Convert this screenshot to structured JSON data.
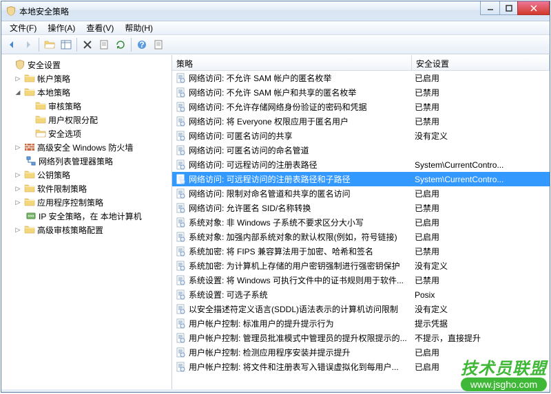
{
  "window": {
    "title": "本地安全策略"
  },
  "menu": {
    "file": "文件(F)",
    "action": "操作(A)",
    "view": "查看(V)",
    "help": "帮助(H)"
  },
  "tree": {
    "root": "安全设置",
    "n1": "帐户策略",
    "n2": "本地策略",
    "n2a": "审核策略",
    "n2b": "用户权限分配",
    "n2c": "安全选项",
    "n3": "高级安全 Windows 防火墙",
    "n4": "网络列表管理器策略",
    "n5": "公钥策略",
    "n6": "软件限制策略",
    "n7": "应用程序控制策略",
    "n8": "IP 安全策略，在 本地计算机",
    "n9": "高级审核策略配置"
  },
  "columns": {
    "c1": "策略",
    "c2": "安全设置"
  },
  "rows": [
    {
      "policy": "网络访问: 不允许 SAM 帐户的匿名枚举",
      "value": "已启用"
    },
    {
      "policy": "网络访问: 不允许 SAM 帐户和共享的匿名枚举",
      "value": "已禁用"
    },
    {
      "policy": "网络访问: 不允许存储网络身份验证的密码和凭据",
      "value": "已禁用"
    },
    {
      "policy": "网络访问: 将 Everyone 权限应用于匿名用户",
      "value": "已禁用"
    },
    {
      "policy": "网络访问: 可匿名访问的共享",
      "value": "没有定义"
    },
    {
      "policy": "网络访问: 可匿名访问的命名管道",
      "value": ""
    },
    {
      "policy": "网络访问: 可远程访问的注册表路径",
      "value": "System\\CurrentContro..."
    },
    {
      "policy": "网络访问: 可远程访问的注册表路径和子路径",
      "value": "System\\CurrentContro...",
      "sel": true
    },
    {
      "policy": "网络访问: 限制对命名管道和共享的匿名访问",
      "value": "已启用"
    },
    {
      "policy": "网络访问: 允许匿名 SID/名称转换",
      "value": "已禁用"
    },
    {
      "policy": "系统对象: 非 Windows 子系统不要求区分大小写",
      "value": "已启用"
    },
    {
      "policy": "系统对象: 加强内部系统对象的默认权限(例如，符号链接)",
      "value": "已启用"
    },
    {
      "policy": "系统加密: 将 FIPS 兼容算法用于加密、哈希和签名",
      "value": "已禁用"
    },
    {
      "policy": "系统加密: 为计算机上存储的用户密钥强制进行强密钥保护",
      "value": "没有定义"
    },
    {
      "policy": "系统设置: 将 Windows 可执行文件中的证书规则用于软件...",
      "value": "已禁用"
    },
    {
      "policy": "系统设置: 可选子系统",
      "value": "Posix"
    },
    {
      "policy": "以安全描述符定义语言(SDDL)语法表示的计算机访问限制",
      "value": "没有定义"
    },
    {
      "policy": "用户帐户控制: 标准用户的提升提示行为",
      "value": "提示凭据"
    },
    {
      "policy": "用户帐户控制: 管理员批准模式中管理员的提升权限提示的...",
      "value": "不提示，直接提升"
    },
    {
      "policy": "用户帐户控制: 检测应用程序安装并提示提升",
      "value": "已启用"
    },
    {
      "policy": "用户帐户控制: 将文件和注册表写入错误虚拟化到每用户...",
      "value": "已启用"
    }
  ],
  "watermark": {
    "top": "技术员联盟",
    "bot": "www.jsgho.com"
  }
}
